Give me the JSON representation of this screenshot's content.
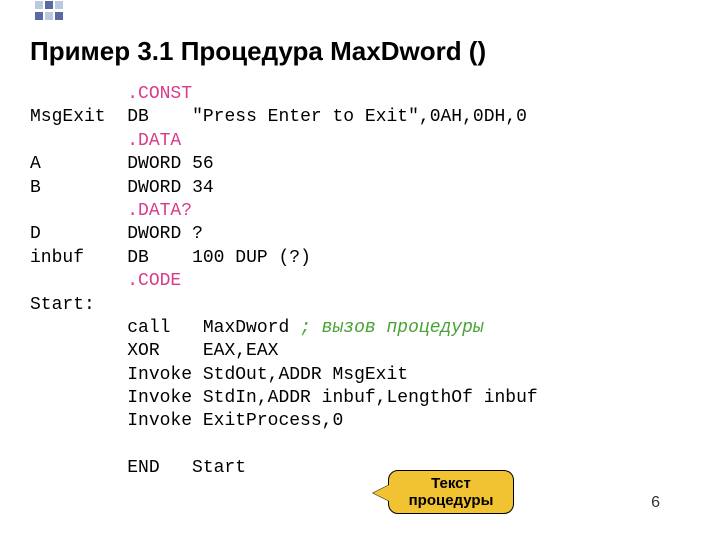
{
  "title": "Пример 3.1 Процедура MaxDword ()",
  "code": {
    "l1_dir": ".CONST",
    "l2_lbl": "MsgExit",
    "l2_op": "DB",
    "l2_val": "\"Press Enter to Exit\",0AH,0DH,0",
    "l3_dir": ".DATA",
    "l4_lbl": "A",
    "l4_op": "DWORD",
    "l4_val": "56",
    "l5_lbl": "B",
    "l5_op": "DWORD",
    "l5_val": "34",
    "l6_dir": ".DATA?",
    "l7_lbl": "D",
    "l7_op": "DWORD",
    "l7_val": "?",
    "l8_lbl": "inbuf",
    "l8_op": "DB",
    "l8_val": "100 DUP (?)",
    "l9_dir": ".CODE",
    "l10_lbl": "Start:",
    "l11_op": "call",
    "l11_val": "MaxDword",
    "l11_cmt": "; вызов процедуры",
    "l12_op": "XOR",
    "l12_val": "EAX,EAX",
    "l13_op": "Invoke",
    "l13_val": "StdOut,ADDR MsgExit",
    "l14_op": "Invoke",
    "l14_val": "StdIn,ADDR inbuf,LengthOf inbuf",
    "l15_op": "Invoke",
    "l15_val": "ExitProcess,0",
    "l16_op": "END",
    "l16_val": "Start"
  },
  "callout": "Текст процедуры",
  "page_number": "6"
}
